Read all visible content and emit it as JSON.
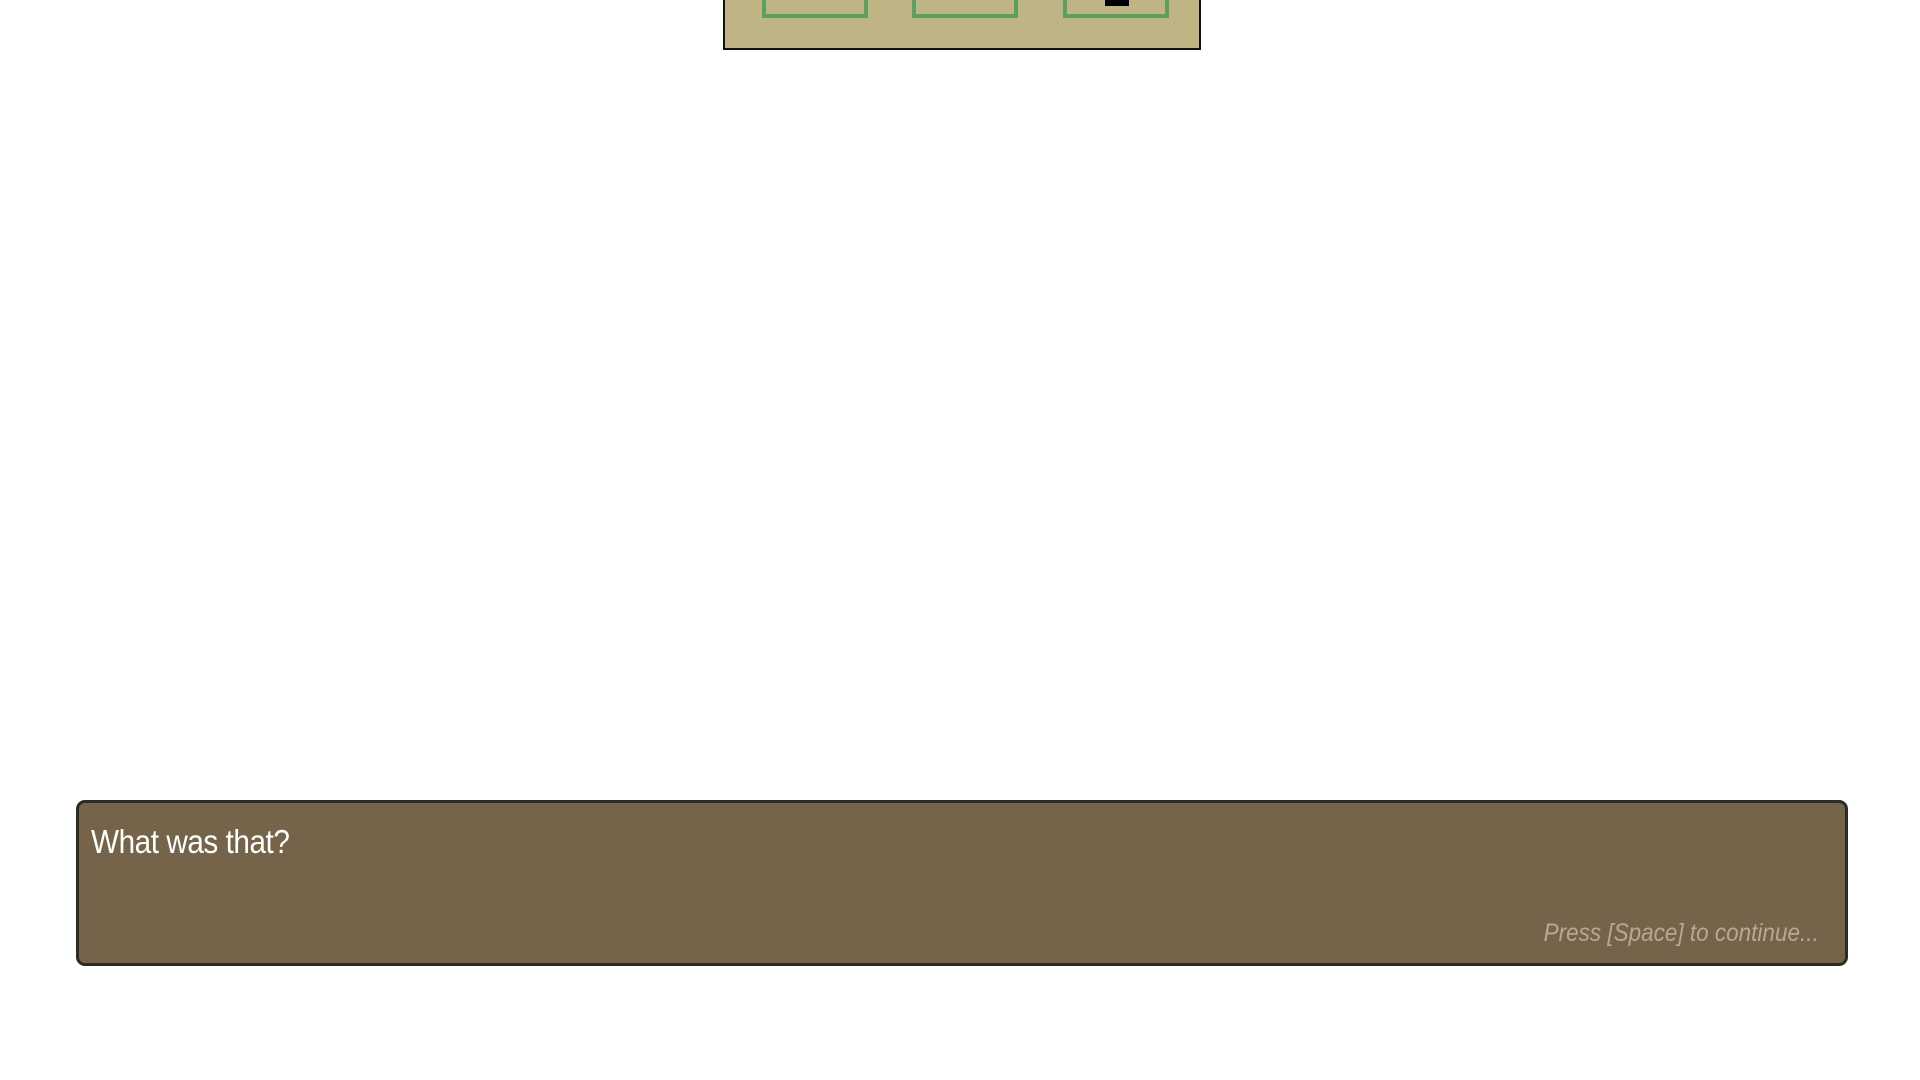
{
  "dialogue": {
    "text": "What was that?",
    "continue_hint": "Press [Space] to continue..."
  },
  "colors": {
    "background": "#ffffff",
    "room_floor": "#bfb483",
    "tile_outline": "#5c9f5f",
    "player": "#3ee860",
    "dialogue_bg": "#75644a",
    "dialogue_text": "#ffffff",
    "hint_text": "#b6aa94"
  }
}
